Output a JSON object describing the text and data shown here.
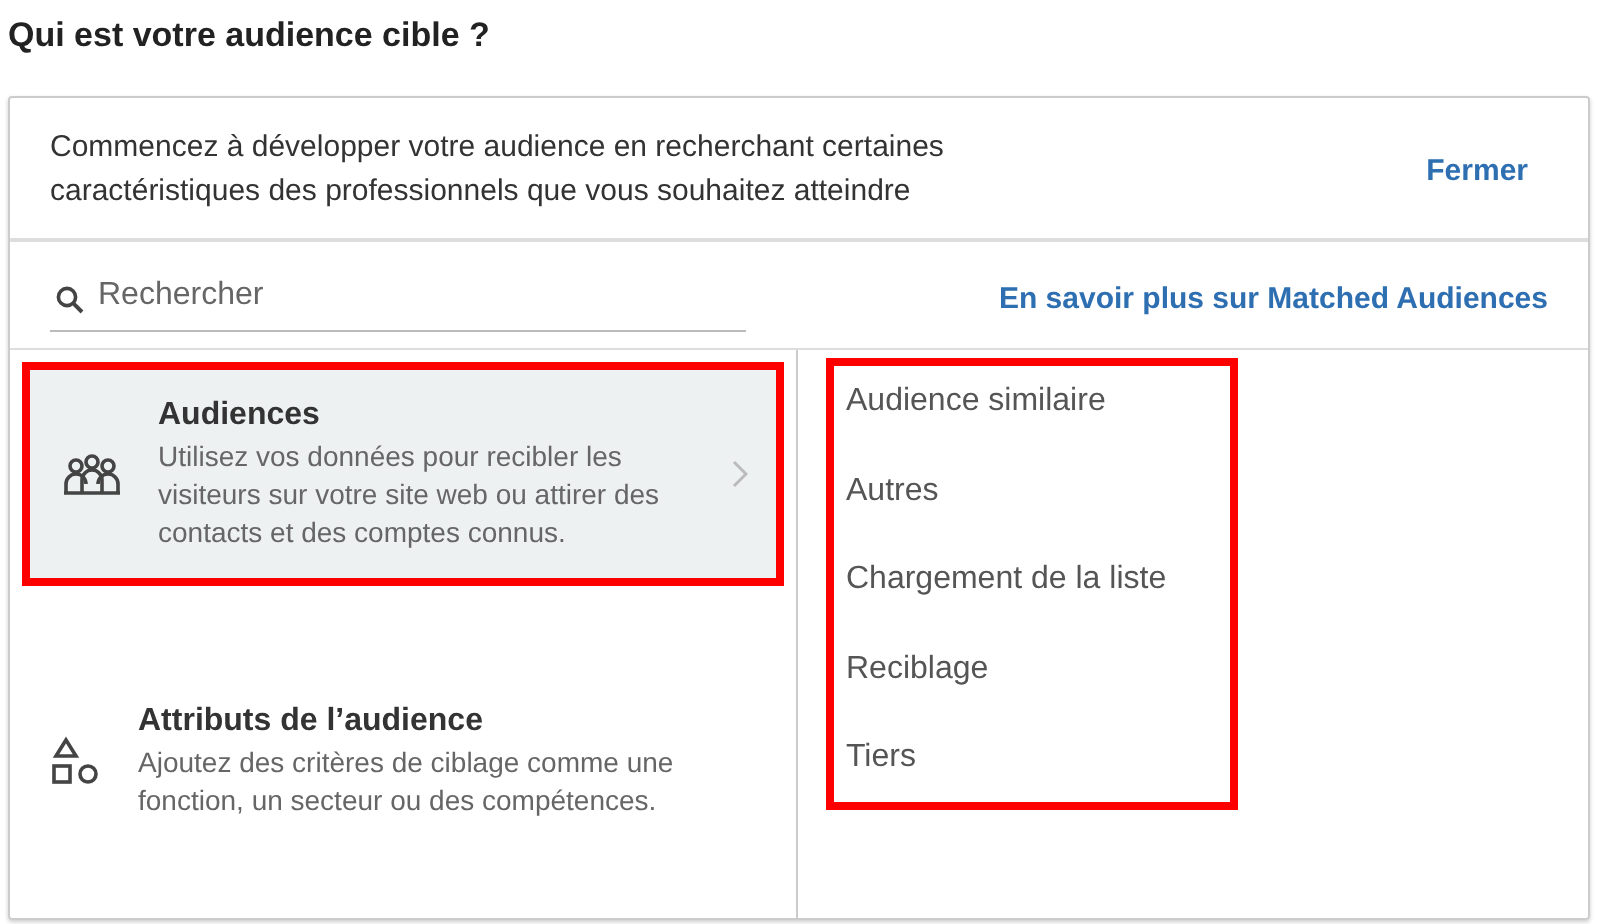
{
  "title": "Qui est votre audience cible ?",
  "intro": {
    "text": "Commencez à développer votre audience en recherchant certaines caractéristiques des professionnels que vous souhaitez atteindre",
    "close_link": "Fermer"
  },
  "search": {
    "placeholder": "Rechercher"
  },
  "learn_more_link": "En savoir plus sur Matched Audiences",
  "categories": [
    {
      "kind": "people",
      "title": "Audiences",
      "description": "Utilisez vos données pour recibler les visiteurs sur votre site web ou attirer des contacts et des comptes connus.",
      "selected": true,
      "highlighted": true
    },
    {
      "kind": "shapes",
      "title": "Attributs de l’audience",
      "description": "Ajoutez des critères de ciblage comme une fonction, un secteur ou des compétences.",
      "selected": false,
      "highlighted": false
    }
  ],
  "options": {
    "highlighted": true,
    "items": [
      "Audience similaire",
      "Autres",
      "Chargement de la liste",
      "Reciblage",
      "Tiers"
    ]
  }
}
